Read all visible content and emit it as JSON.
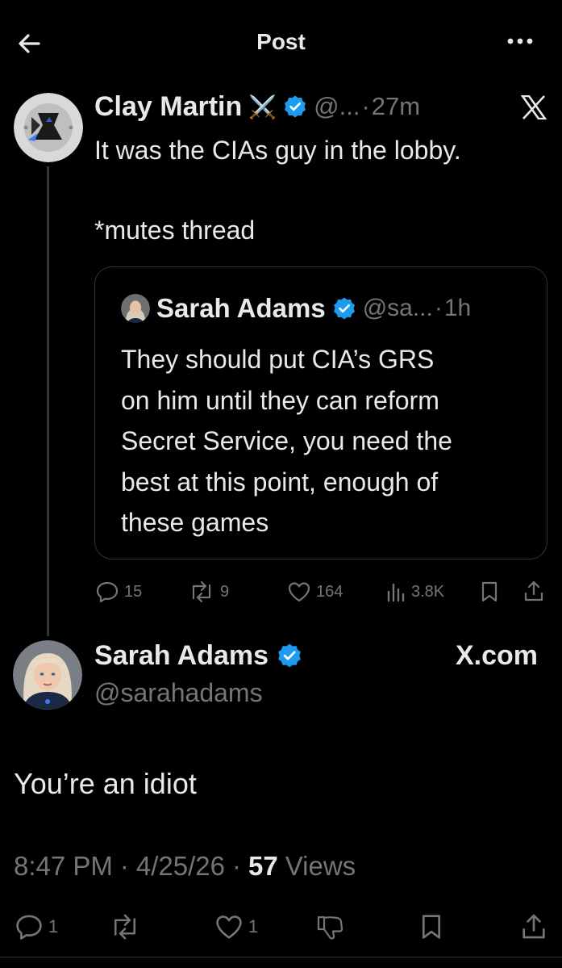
{
  "header": {
    "title": "Post",
    "back_icon": "arrow-left-icon",
    "more_icon": "more-dots-icon"
  },
  "reply_tweet": {
    "author_name": "Clay Martin",
    "author_emoji": "⚔️",
    "handle": "@...",
    "separator": "·",
    "time": "27m",
    "source_icon": "x-logo-icon",
    "text_line1": "It was the CIAs guy in the lobby.",
    "text_line2": "*mutes thread",
    "quote": {
      "author_name": "Sarah Adams",
      "handle": "@sa...",
      "separator": "·",
      "time": "1h",
      "lines": [
        "They should put CIA’s GRS",
        "on him until they can reform",
        "Secret Service, you need the",
        "best at this point, enough of",
        "these games"
      ]
    },
    "stats": {
      "replies": "15",
      "reposts": "9",
      "likes": "164",
      "views": "3.8K"
    }
  },
  "main_tweet": {
    "author_name": "Sarah Adams",
    "handle": "@sarahadams",
    "site_label": "X.com",
    "text": "You’re an idiot",
    "time": "8:47 PM",
    "date": "4/25/26",
    "separator": "·",
    "views_count": "57",
    "views_label": "Views",
    "actions": {
      "replies": "1",
      "likes": "1"
    }
  },
  "colors": {
    "background": "#000000",
    "text": "#e7e9ea",
    "muted": "#71767b",
    "verified": "#1d9bf0",
    "border": "#2f3336"
  }
}
